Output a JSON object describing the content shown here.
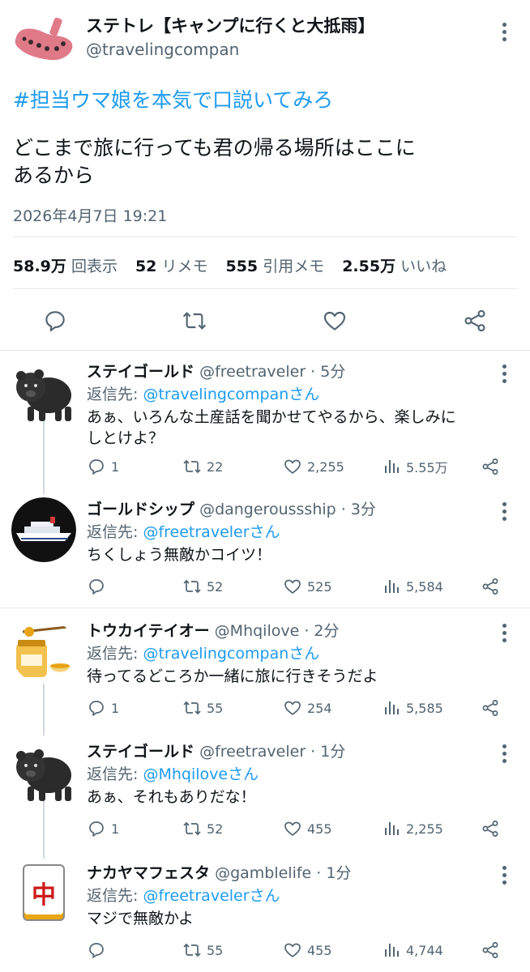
{
  "main": {
    "author_name": "ステトレ【キャンプに行くと大抵雨】",
    "author_handle": "@travelingcompan",
    "hashtag": "#担当ウマ娘を本気で口説いてみろ",
    "text": "どこまで旅に行っても君の帰る場所はここに\nあるから",
    "timestamp": "2026年4月7日 19:21",
    "stats": [
      {
        "value": "58.9万",
        "label": "回表示"
      },
      {
        "value": "52",
        "label": "リメモ"
      },
      {
        "value": "555",
        "label": "引用メモ"
      },
      {
        "value": "2.55万",
        "label": "いいね"
      }
    ]
  },
  "replies": [
    {
      "name": "ステイゴールド",
      "handle": "@freetraveler · 5分",
      "reply_prefix": "返信先: ",
      "reply_to": "@travelingcompanさん",
      "text": "あぁ、いろんな土産話を聞かせてやるから、楽しみに\nしとけよ？",
      "replies": "1",
      "reposts": "22",
      "likes": "2,255",
      "views": "5.55万",
      "avatar": "black-dog"
    },
    {
      "name": "ゴールドシップ",
      "handle": "@dangeroussship · 3分",
      "reply_prefix": "返信先: ",
      "reply_to": "@freetravelerさん",
      "text": "ちくしょう無敵かコイツ！",
      "replies": "",
      "reposts": "52",
      "likes": "525",
      "views": "5,584",
      "avatar": "ship"
    },
    {
      "name": "トウカイテイオー",
      "handle": "@Mhqilove · 2分",
      "reply_prefix": "返信先: ",
      "reply_to": "@travelingcompanさん",
      "text": "待ってるどころか一緒に旅に行きそうだよ",
      "replies": "1",
      "reposts": "55",
      "likes": "254",
      "views": "5,585",
      "avatar": "honey-jar"
    },
    {
      "name": "ステイゴールド",
      "handle": "@freetraveler · 1分",
      "reply_prefix": "返信先: ",
      "reply_to": "@Mhqiloveさん",
      "text": "あぁ、それもありだな！",
      "replies": "1",
      "reposts": "52",
      "likes": "455",
      "views": "2,255",
      "avatar": "black-dog"
    },
    {
      "name": "ナカヤマフェスタ",
      "handle": "@gamblelife · 1分",
      "reply_prefix": "返信先: ",
      "reply_to": "@freetravelerさん",
      "text": "マジで無敵かよ",
      "replies": "",
      "reposts": "55",
      "likes": "455",
      "views": "4,744",
      "avatar": "mahjong-tile",
      "tile_char": "中"
    }
  ],
  "colors": {
    "accent": "#1d9bf0",
    "muted": "#536471",
    "text": "#0f1419",
    "divider": "#e6e9ec"
  }
}
